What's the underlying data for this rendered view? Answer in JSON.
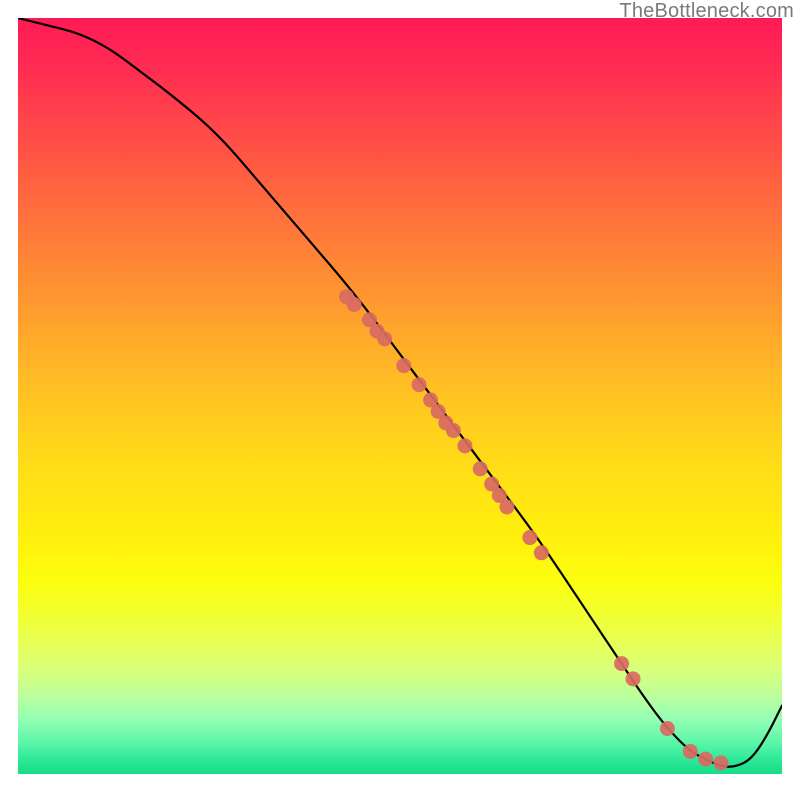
{
  "watermark": "TheBottleneck.com",
  "chart_data": {
    "type": "line",
    "title": "",
    "xlabel": "",
    "ylabel": "",
    "xlim": [
      0,
      100
    ],
    "ylim": [
      0,
      100
    ],
    "grid": false,
    "series": [
      {
        "name": "curve",
        "x": [
          0,
          4,
          8,
          12,
          16,
          20,
          26,
          32,
          38,
          44,
          50,
          56,
          62,
          68,
          74,
          78,
          82,
          85,
          88,
          90,
          92,
          94,
          96,
          98,
          100
        ],
        "y": [
          100,
          99,
          98,
          96,
          93,
          90,
          85,
          78,
          71,
          64,
          56,
          48,
          40,
          32,
          23,
          17,
          11,
          7,
          4,
          3,
          2,
          2,
          3,
          6,
          10
        ]
      }
    ],
    "markers": [
      {
        "x": 43.0,
        "y": 63.5
      },
      {
        "x": 44.0,
        "y": 62.5
      },
      {
        "x": 46.0,
        "y": 60.5
      },
      {
        "x": 47.0,
        "y": 59.0
      },
      {
        "x": 48.0,
        "y": 58.0
      },
      {
        "x": 50.5,
        "y": 54.5
      },
      {
        "x": 52.5,
        "y": 52.0
      },
      {
        "x": 54.0,
        "y": 50.0
      },
      {
        "x": 55.0,
        "y": 48.5
      },
      {
        "x": 56.0,
        "y": 47.0
      },
      {
        "x": 57.0,
        "y": 46.0
      },
      {
        "x": 58.5,
        "y": 44.0
      },
      {
        "x": 60.5,
        "y": 41.0
      },
      {
        "x": 62.0,
        "y": 39.0
      },
      {
        "x": 63.0,
        "y": 37.5
      },
      {
        "x": 64.0,
        "y": 36.0
      },
      {
        "x": 67.0,
        "y": 32.0
      },
      {
        "x": 68.5,
        "y": 30.0
      },
      {
        "x": 79.0,
        "y": 15.5
      },
      {
        "x": 80.5,
        "y": 13.5
      },
      {
        "x": 85.0,
        "y": 7.0
      },
      {
        "x": 88.0,
        "y": 4.0
      },
      {
        "x": 90.0,
        "y": 3.0
      },
      {
        "x": 92.0,
        "y": 2.5
      }
    ],
    "colors": {
      "curve": "#000000",
      "marker_fill": "#d96a62",
      "marker_stroke": "#b84d45"
    }
  }
}
